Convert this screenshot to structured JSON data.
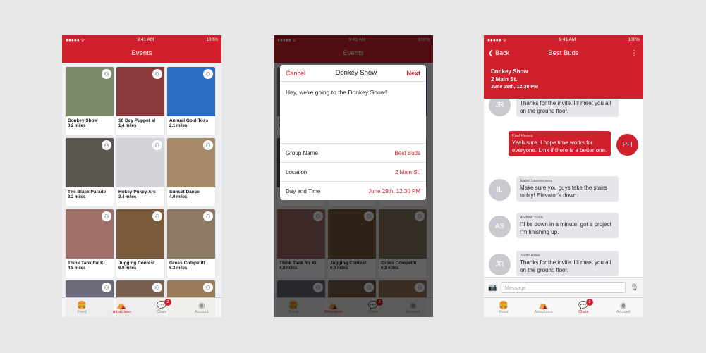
{
  "status": {
    "time": "9:41 AM",
    "battery": "100%",
    "signal": "●●●●● ᯤ"
  },
  "events": {
    "title": "Events",
    "tiles": [
      {
        "name": "Donkey Show",
        "dist": "0.2 miles",
        "bg": "#7d8a6a"
      },
      {
        "name": "10 Day Puppet sl",
        "dist": "1.4 miles",
        "bg": "#8a3a3a"
      },
      {
        "name": "Annual Gold Toss",
        "dist": "2.1 miles",
        "bg": "#2a6fc4"
      },
      {
        "name": "The Black Parade",
        "dist": "3.2 miles",
        "bg": "#5c5650"
      },
      {
        "name": "Hokey Pokey Arc",
        "dist": "3.4 miles",
        "bg": "#d4d4d8"
      },
      {
        "name": "Sunset Dance",
        "dist": "4.0 miles",
        "bg": "#a48a68"
      },
      {
        "name": "Think Tank for Ki",
        "dist": "4.8 miles",
        "bg": "#a0706a"
      },
      {
        "name": "Jugging Contest",
        "dist": "6.0 miles",
        "bg": "#7a5a3a"
      },
      {
        "name": "Gross Competiti",
        "dist": "6.3 miles",
        "bg": "#8c7a64"
      },
      {
        "name": "",
        "dist": "",
        "bg": "#6a6a7a"
      },
      {
        "name": "",
        "dist": "",
        "bg": "#7a6050"
      },
      {
        "name": "",
        "dist": "",
        "bg": "#9a7a5a"
      }
    ]
  },
  "tabs": {
    "food": "Food",
    "attractions": "Attractions",
    "chats": "Chats",
    "account": "Account",
    "chat_count": "2"
  },
  "modal": {
    "cancel": "Cancel",
    "title": "Donkey Show",
    "next": "Next",
    "message": "Hey, we're going to the Donkey Show!",
    "rows": [
      {
        "label": "Group Name",
        "value": "Best Buds"
      },
      {
        "label": "Location",
        "value": "2 Main St."
      },
      {
        "label": "Day and Time",
        "value": "June 29th, 12:30 PM"
      }
    ]
  },
  "chat": {
    "back": "Back",
    "title": "Best Buds",
    "banner": {
      "event": "Donkey Show",
      "location": "2 Main St.",
      "time": "June 29th, 12:30 PM"
    },
    "messages": [
      {
        "initials": "JR",
        "name": "Justin Rose",
        "text": "Thanks for the invite. I'll meet you all on the ground floor.",
        "mine": false
      },
      {
        "initials": "PH",
        "name": "Paul Hwang",
        "text": "Yeah sure. I hope time works for everyone. Lmk if there is a better one.",
        "mine": true
      },
      {
        "initials": "IL",
        "name": "Isabel Laurenceau",
        "text": "Make sure you guys take the stairs today! Elevator's down.",
        "mine": false
      },
      {
        "initials": "AS",
        "name": "Andrew Sosa",
        "text": "I'll be down in a minute, got a project I'm finishing up.",
        "mine": false
      },
      {
        "initials": "JR",
        "name": "Justin Rose",
        "text": "Thanks for the invite. I'll meet you all on the ground floor.",
        "mine": false
      }
    ],
    "placeholder": "Message"
  },
  "colors": {
    "brand": "#d0202d"
  }
}
